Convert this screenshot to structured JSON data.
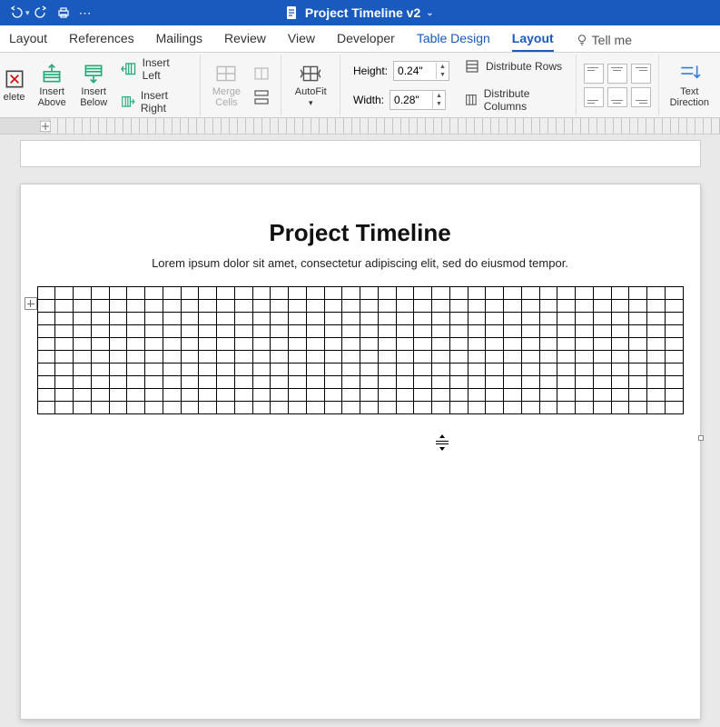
{
  "title": "Project Timeline v2",
  "tabs": {
    "layout1": "Layout",
    "references": "References",
    "mailings": "Mailings",
    "review": "Review",
    "view": "View",
    "developer": "Developer",
    "table_design": "Table Design",
    "layout2": "Layout",
    "tellme": "Tell me"
  },
  "ribbon": {
    "delete": "elete",
    "insert_above": "Insert\nAbove",
    "insert_below": "Insert\nBelow",
    "insert_left": "Insert Left",
    "insert_right": "Insert Right",
    "merge_cells": "Merge\nCells",
    "autofit": "AutoFit",
    "height_label": "Height:",
    "height_value": "0.24\"",
    "width_label": "Width:",
    "width_value": "0.28\"",
    "distribute_rows": "Distribute Rows",
    "distribute_columns": "Distribute Columns",
    "text_direction": "Text\nDirection"
  },
  "document": {
    "title": "Project Timeline",
    "body": "Lorem ipsum dolor sit amet, consectetur adipiscing elit, sed do eiusmod tempor.",
    "table": {
      "rows": 10,
      "cols": 36
    }
  }
}
